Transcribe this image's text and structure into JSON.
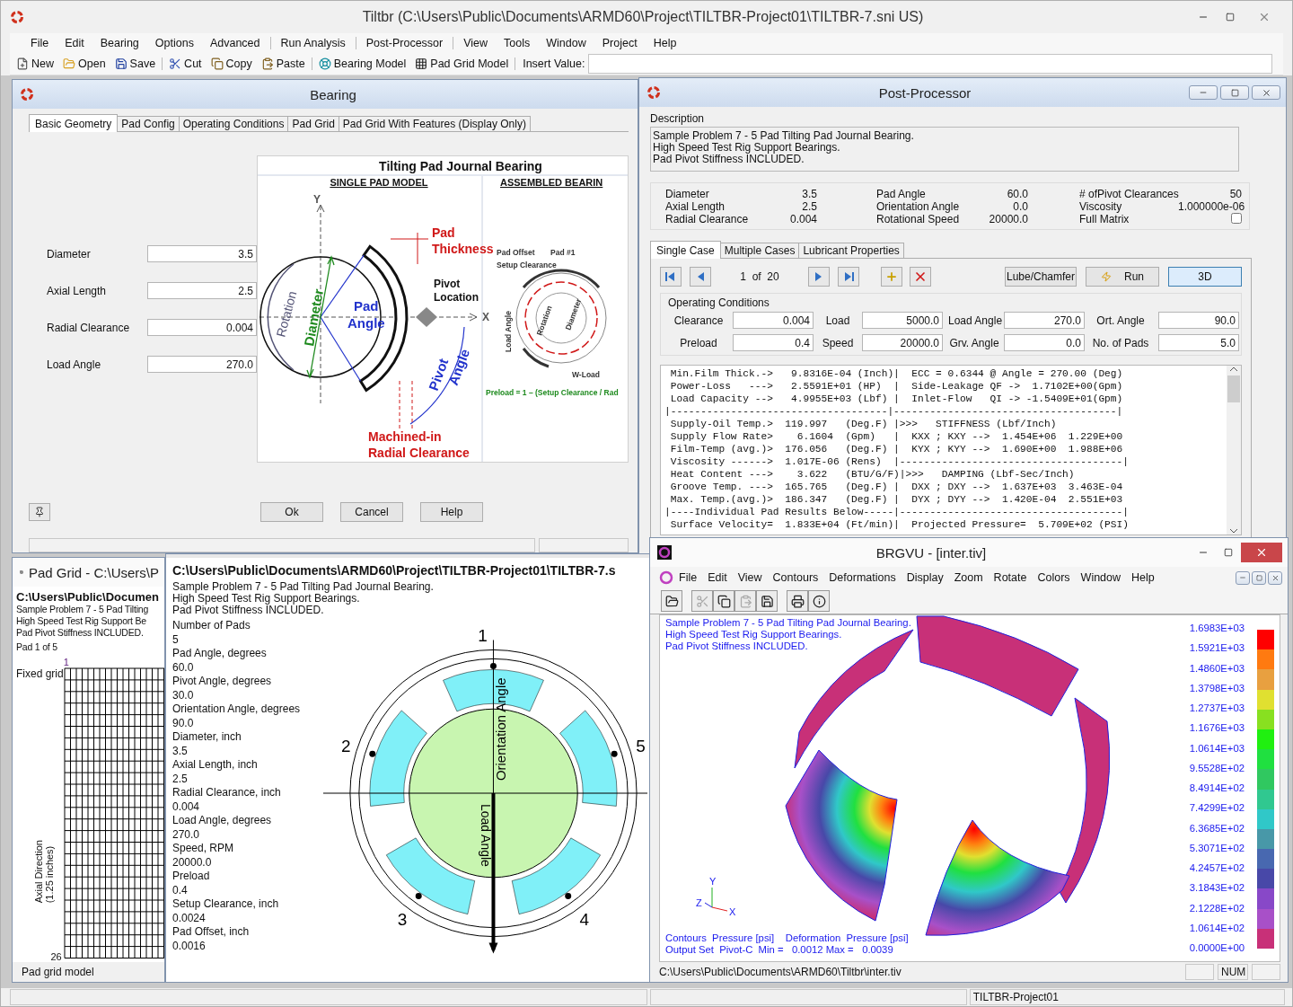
{
  "app": {
    "title": "Tiltbr (C:\\Users\\Public\\Documents\\ARMD60\\Project\\TILTBR-Project01\\TILTBR-7.sni US)"
  },
  "menu": [
    [
      "File",
      "Edit",
      "Bearing",
      "Options",
      "Advanced"
    ],
    [
      "Run Analysis"
    ],
    [
      "Post-Processor"
    ],
    [
      "View",
      "Tools",
      "Window",
      "Project",
      "Help"
    ]
  ],
  "toolbar": [
    [
      {
        "kind": "button",
        "label": "New"
      },
      {
        "kind": "button",
        "label": "Open"
      },
      {
        "kind": "button",
        "label": "Save"
      }
    ],
    [
      {
        "kind": "button",
        "label": "Cut"
      },
      {
        "kind": "button",
        "label": "Copy"
      },
      {
        "kind": "button",
        "label": "Paste"
      }
    ],
    [
      {
        "kind": "button",
        "label": "Bearing Model"
      },
      {
        "kind": "button",
        "label": "Pad Grid Model"
      }
    ],
    [
      {
        "kind": "field",
        "label": "Insert Value:"
      }
    ]
  ],
  "bearing": {
    "title": "Bearing",
    "tabs": [
      {
        "label": "Basic Geometry",
        "selected": true
      },
      {
        "label": "Pad Config",
        "selected": false
      },
      {
        "label": "Operating Conditions",
        "selected": false
      },
      {
        "label": "Pad Grid",
        "selected": false
      },
      {
        "label": "Pad Grid With Features (Display Only)",
        "selected": false
      }
    ],
    "fields": [
      {
        "label": "Diameter",
        "value": "3.5"
      },
      {
        "label": "Axial Length",
        "value": "2.5"
      },
      {
        "label": "Radial Clearance",
        "value": "0.004"
      },
      {
        "label": "Load Angle",
        "value": "270.0"
      }
    ],
    "diagram": {
      "title": "Tilting Pad Journal Bearing",
      "left_heading": "SINGLE PAD MODEL",
      "right_heading": "ASSEMBLED BEARIN",
      "labels": [
        "Y",
        "X",
        "Pad",
        "Thickness",
        "Pivot",
        "Location",
        "Pad",
        "Angle",
        "Rotation",
        "Diameter",
        "Pivot",
        "Angle",
        "Machined-in",
        "Radial Clearance"
      ],
      "mini_labels": [
        "Pad Offset",
        "Pad #1",
        "Setup Clearance",
        "Load Angle",
        "Rotation",
        "Diameter",
        "W-Load",
        "Preload = 1 – (Setup Clearance / Rad"
      ]
    },
    "buttons": [
      "Ok",
      "Cancel",
      "Help"
    ]
  },
  "post": {
    "title": "Post-Processor",
    "description_label": "Description",
    "description": [
      "Sample Problem 7 - 5 Pad Tilting Pad Journal Bearing.",
      "High Speed Test Rig Support Bearings.",
      "Pad Pivot Stiffness INCLUDED."
    ],
    "params": [
      {
        "kind": "value",
        "label": "Diameter",
        "value": "3.5"
      },
      {
        "kind": "value",
        "label": "Pad Angle",
        "value": "60.0"
      },
      {
        "kind": "value",
        "label": "# ofPivot Clearances",
        "value": "50"
      },
      {
        "kind": "value",
        "label": "Axial Length",
        "value": "2.5"
      },
      {
        "kind": "value",
        "label": "Orientation Angle",
        "value": "0.0"
      },
      {
        "kind": "value",
        "label": "Viscosity",
        "value": "1.000000e-06"
      },
      {
        "kind": "value",
        "label": "Radial Clearance",
        "value": "0.004"
      },
      {
        "kind": "value",
        "label": "Rotational Speed",
        "value": "20000.0"
      },
      {
        "kind": "checkbox",
        "label": "Full Matrix",
        "checked": false
      }
    ],
    "tabs": [
      {
        "label": "Single Case",
        "selected": true
      },
      {
        "label": "Multiple Cases",
        "selected": false
      },
      {
        "label": "Lubricant Properties",
        "selected": false
      }
    ],
    "case_counter": "1  of  20",
    "buttons": [
      {
        "label": "Lube/Chamfer",
        "selected": false
      },
      {
        "label": "Run",
        "selected": false
      },
      {
        "label": "3D",
        "selected": true
      }
    ],
    "conditions_label": "Operating Conditions",
    "conditions": [
      {
        "label": "Clearance",
        "value": "0.004"
      },
      {
        "label": "Load",
        "value": "5000.0"
      },
      {
        "label": "Load Angle",
        "value": "270.0"
      },
      {
        "label": "Ort. Angle",
        "value": "90.0"
      },
      {
        "label": "Preload",
        "value": "0.4"
      },
      {
        "label": "Speed",
        "value": "20000.0"
      },
      {
        "label": "Grv. Angle",
        "value": "0.0"
      },
      {
        "label": "No. of Pads",
        "value": "5.0"
      }
    ],
    "results": [
      " Min.Film Thick.->   9.8316E-04 (Inch)|  ECC = 0.6344 @ Angle = 270.00 (Deg)",
      " Power-Loss   --->   2.5591E+01 (HP)  |  Side-Leakage QF ->  1.7102E+00(Gpm)",
      " Load Capacity -->   4.9955E+03 (Lbf) |  Inlet-Flow   QI -> -1.5409E+01(Gpm)",
      "|------------------------------------|-------------------------------------|",
      " Supply-Oil Temp.>  119.997   (Deg.F) |>>>   STIFFNESS (Lbf/Inch)",
      " Supply Flow Rate>    6.1604  (Gpm)   |  KXX ; KXY -->  1.454E+06  1.229E+00",
      " Film-Temp (avg.)>  176.056   (Deg.F) |  KYX ; KYY -->  1.690E+00  1.988E+06",
      " Viscosity ------>  1.017E-06 (Rens)  |-------------------------------------|",
      " Heat Content --->    3.622   (BTU/G/F)|>>>   DAMPING (Lbf-Sec/Inch)",
      " Groove Temp. --->  165.765   (Deg.F) |  DXX ; DXY -->  1.637E+03  3.463E-04",
      " Max. Temp.(avg.)>  186.347   (Deg.F) |  DYX ; DYY -->  1.420E-04  2.551E+03",
      "|----Individual Pad Results Below-----|-------------------------------------|",
      " Surface Velocity=  1.833E+04 (Ft/min)|  Projected Pressure=  5.709E+02 (PSI)"
    ]
  },
  "pad_grid": {
    "title": "Pad Grid - C:\\Users\\P",
    "path": "C:\\Users\\Public\\Documen",
    "description": [
      "Sample Problem 7 - 5 Pad Tilting",
      "High Speed Test Rig Support Be",
      "Pad Pivot Stiffness INCLUDED."
    ],
    "pad": "Pad 1 of 5",
    "column_start": "1",
    "row_label": "Fixed grid",
    "axis_label": [
      "Axial Direction",
      "(1.25 inches)"
    ],
    "row_end": "26",
    "status": "Pad grid model"
  },
  "printout": {
    "path": "C:\\Users\\Public\\Documents\\ARMD60\\Project\\TILTBR-Project01\\TILTBR-7.s",
    "description": [
      "Sample Problem 7 - 5 Pad Tilting Pad Journal Bearing.",
      "High Speed Test Rig Support Bearings.",
      "Pad Pivot Stiffness INCLUDED."
    ],
    "properties": [
      {
        "label": "Number of Pads",
        "value": "5"
      },
      {
        "label": "Pad Angle, degrees",
        "value": "60.0"
      },
      {
        "label": "Pivot Angle, degrees",
        "value": "30.0"
      },
      {
        "label": "Orientation Angle, degrees",
        "value": "90.0"
      },
      {
        "label": "Diameter, inch",
        "value": "3.5"
      },
      {
        "label": "Axial Length,  inch",
        "value": "2.5"
      },
      {
        "label": "Radial Clearance,  inch",
        "value": "0.004"
      },
      {
        "label": "Load Angle, degrees",
        "value": "270.0"
      },
      {
        "label": "Speed, RPM",
        "value": "20000.0"
      },
      {
        "label": "Preload",
        "value": "0.4"
      },
      {
        "label": "Setup Clearance,  inch",
        "value": "0.0024"
      },
      {
        "label": "Pad Offset,  inch",
        "value": "0.0016"
      }
    ],
    "pad_numbers": [
      "1",
      "2",
      "3",
      "4",
      "5"
    ],
    "orientation_label": "Orientation Angle",
    "load_label": "Load Angle"
  },
  "brgvu": {
    "title": "BRGVU - [inter.tiv]",
    "menu": [
      "File",
      "Edit",
      "View",
      "Contours",
      "Deformations",
      "Display",
      "Zoom",
      "Rotate",
      "Colors",
      "Window",
      "Help"
    ],
    "toolbar": [
      {
        "disabled": false
      },
      {
        "disabled": true
      },
      {
        "disabled": false
      },
      {
        "disabled": true
      },
      {
        "disabled": false
      },
      {
        "disabled": false
      },
      {
        "disabled": false
      }
    ],
    "description": [
      "Sample Problem 7 - 5 Pad Tilting Pad Journal Bearing.",
      "High Speed Test Rig Support Bearings.",
      "Pad Pivot Stiffness INCLUDED."
    ],
    "legend_values": [
      "1.6983E+03",
      "1.5921E+03",
      "1.4860E+03",
      "1.3798E+03",
      "1.2737E+03",
      "1.1676E+03",
      "1.0614E+03",
      "9.5528E+02",
      "8.4914E+02",
      "7.4299E+02",
      "6.3685E+02",
      "5.3071E+02",
      "4.2457E+02",
      "3.1843E+02",
      "2.1228E+02",
      "1.0614E+02",
      "0.0000E+00"
    ],
    "legend_bands": [
      {
        "color": "#ff0000"
      },
      {
        "color": "#ff7a10"
      },
      {
        "color": "#e8a040"
      },
      {
        "color": "#e0e030"
      },
      {
        "color": "#88e020"
      },
      {
        "color": "#20f010"
      },
      {
        "color": "#20e040"
      },
      {
        "color": "#30c860"
      },
      {
        "color": "#30c890"
      },
      {
        "color": "#30c8c8"
      },
      {
        "color": "#4898a8"
      },
      {
        "color": "#4868b0"
      },
      {
        "color": "#4848a8"
      },
      {
        "color": "#8848c8"
      },
      {
        "color": "#a850c8"
      },
      {
        "color": "#c83078"
      }
    ],
    "axes_labels": [
      "Y",
      "Z",
      "X"
    ],
    "footer": [
      "Contours  Pressure [psi]    Deformation  Pressure [psi]",
      "Output Set  Pivot-C  Min =   0.0012 Max =   0.0039"
    ],
    "status": "C:\\Users\\Public\\Documents\\ARMD60\\Tiltbr\\inter.tiv",
    "status_indicator": "NUM"
  },
  "status_bar": {
    "project": "TILTBR-Project01"
  }
}
